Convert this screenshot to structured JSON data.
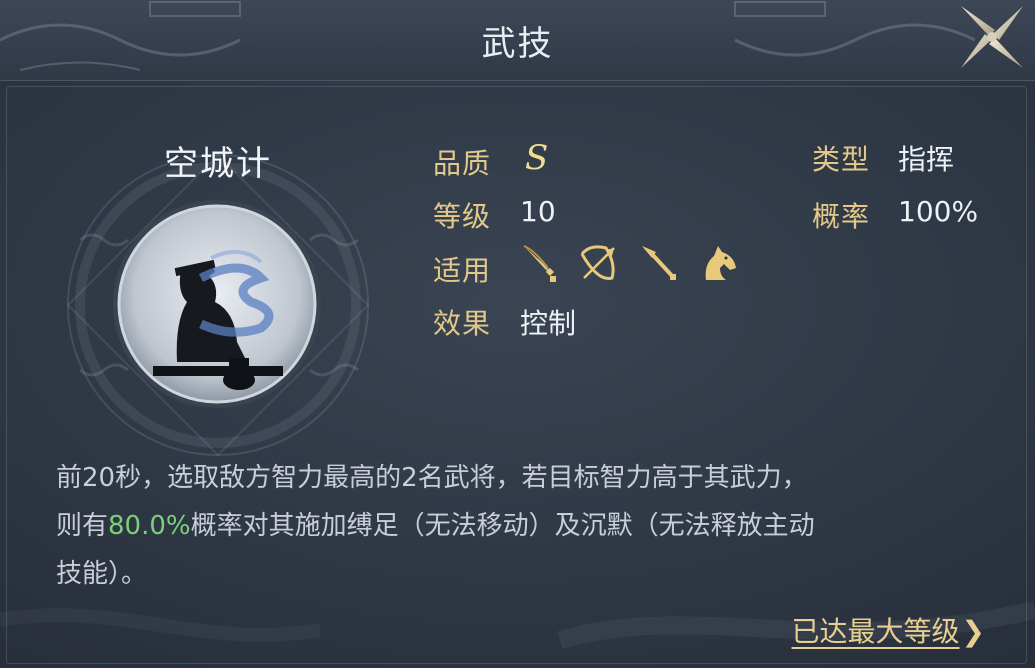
{
  "window": {
    "title": "武技"
  },
  "skill": {
    "name": "空城计",
    "quality_label": "品质",
    "quality_value": "S",
    "level_label": "等级",
    "level_value": "10",
    "applies_label": "适用",
    "effect_label": "效果",
    "effect_value": "控制",
    "type_label": "类型",
    "type_value": "指挥",
    "chance_label": "概率",
    "chance_value": "100%",
    "applies_units": [
      "sword-icon",
      "bow-icon",
      "spear-icon",
      "horse-icon"
    ]
  },
  "description": {
    "line1": "前20秒，选取敌方智力最高的2名武将，若目标智力高于其武力，",
    "line2_pre": "则有",
    "line2_highlight": "80.0%",
    "line2_post": "概率对其施加缚足（无法移动）及沉默（无法释放主动",
    "line3": "技能）。"
  },
  "footer": {
    "max_level_link": "已达最大等级"
  },
  "colors": {
    "label_gold": "#e2c98a",
    "highlight_green": "#7cd07a",
    "quality_gold": "#f1dd8e"
  }
}
